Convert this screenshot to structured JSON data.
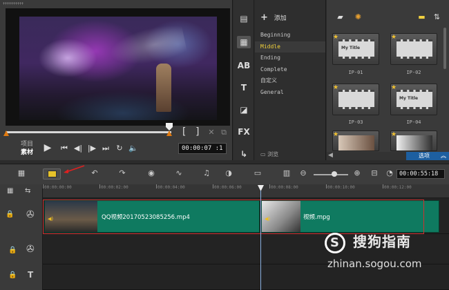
{
  "preview": {
    "project_tab": "项目",
    "clip_tab": "素材",
    "timecode": "00:00:07 :1",
    "bracket_in": "[",
    "bracket_out": "]",
    "play_icon": "play-icon"
  },
  "library": {
    "add_label": "添加",
    "categories": [
      "Beginning",
      "Middle",
      "Ending",
      "Complete",
      "自定义",
      "General"
    ],
    "selected_category": "Middle",
    "browse_label": "浏览",
    "options_label": "选项",
    "thumbnails": [
      {
        "label": "IP-01",
        "title": "My Title"
      },
      {
        "label": "IP-02",
        "title": ""
      },
      {
        "label": "IP-03",
        "title": ""
      },
      {
        "label": "IP-04",
        "title": "My Title"
      },
      {
        "label": "",
        "title": ""
      },
      {
        "label": "",
        "title": ""
      }
    ],
    "side_icons": [
      "media-icon",
      "instant-project-icon",
      "transition-icon",
      "title-icon",
      "graphic-icon",
      "filter-icon",
      "path-icon"
    ],
    "fx_label": "FX",
    "ab_label": "AB",
    "title_glyph": "T"
  },
  "timeline": {
    "timecode": "00:00:55:18",
    "ruler_labels": [
      "00:00:00:00",
      "00:00:02:00",
      "00:00:04:00",
      "00:00:06:00",
      "00:00:08:00",
      "00:00:10:00",
      "00:00:12:00"
    ],
    "clips": [
      {
        "name": "QQ视频20170523085256.mp4"
      },
      {
        "name": "视频.mpg"
      }
    ],
    "title_track_glyph": "T"
  },
  "watermark": {
    "brand": "搜狗指南",
    "logo_glyph": "S",
    "url": "zhinan.sogou.com"
  },
  "colors": {
    "clip": "#0f7a60",
    "accent_orange": "#e07a10",
    "selected_category": "#f3d23a",
    "options_button": "#1d5fa0",
    "highlight_frame": "#d03030"
  }
}
